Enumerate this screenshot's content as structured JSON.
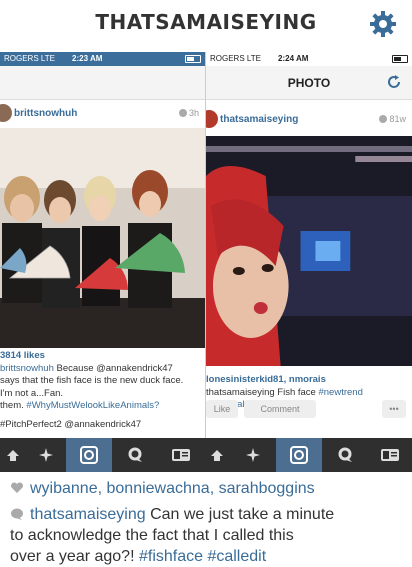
{
  "header": {
    "title": "THATSAMAISEYING"
  },
  "colors": {
    "brand_blue": "#3a6c98",
    "tab_active": "#4c6e91",
    "tabbar_bg": "#2f2f2f"
  },
  "left_screen": {
    "statusbar": {
      "carrier": "ROGERS  LTE",
      "time": "2:23 AM"
    },
    "post": {
      "username": "brittsnowhuh",
      "time_ago": "3h"
    },
    "caption": {
      "likes": "3814 likes",
      "line1_user": "brittsnowhuh",
      "line1_text": " Because @annakendrick47",
      "line2": "says that the fish face is the new duck face.",
      "line3": "I'm not a...Fan.",
      "line4_start": "them. ",
      "line4_tag": "#WhyMustWelookLikeAnimals?",
      "line5": "#PitchPerfect2 @annakendrick47"
    }
  },
  "right_screen": {
    "statusbar": {
      "carrier": "ROGERS  LTE",
      "time": "2:24 AM"
    },
    "nav_title": "PHOTO",
    "post": {
      "username": "thatsamaiseying",
      "time_ago": "81w"
    },
    "caption": {
      "likes": "lonesinisterkid81, nmorais",
      "line1_user": "thatsamaiseying",
      "line1_text": " Fish face ",
      "line1_tag": "#newtrend",
      "line2_tag": "#yourjealous"
    },
    "actions": {
      "like": "Like",
      "comment": "Comment",
      "more": "•••"
    }
  },
  "tabbar": {
    "items": [
      {
        "icon": "home-icon"
      },
      {
        "icon": "explore-icon"
      },
      {
        "icon": "camera-icon"
      },
      {
        "icon": "activity-icon"
      },
      {
        "icon": "profile-icon"
      }
    ]
  },
  "comments": {
    "likers": "wyibanne, bonniewachna, sarahboggins",
    "comment_user": "thatsamaiseying",
    "comment_line1": " Can we just take a minute",
    "comment_line2": "to acknowledge the fact that I called this",
    "comment_line3": "over a year ago?! ",
    "comment_tags": "#fishface #calledit"
  }
}
